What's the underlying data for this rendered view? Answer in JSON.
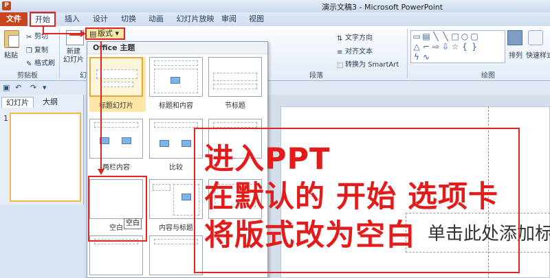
{
  "window": {
    "title": "演示文稿3 - Microsoft PowerPoint",
    "app_icon_label": "P"
  },
  "ribbon_tabs": [
    "文件",
    "开始",
    "插入",
    "设计",
    "切换",
    "动画",
    "幻灯片放映",
    "审阅",
    "视图"
  ],
  "clipboard": {
    "paste": "粘贴",
    "cut": "剪切",
    "copy": "复制",
    "format_painter": "格式刷",
    "group_label": "剪贴板"
  },
  "slides": {
    "new_slide": "新建\n幻灯片",
    "layout": "版式",
    "group_label": "幻"
  },
  "paragraph": {
    "text_direction": "文字方向",
    "align_text": "对齐文本",
    "convert_smartart": "转换为 SmartArt",
    "group_label": "段落"
  },
  "drawing": {
    "arrange": "排列",
    "quick_styles": "快速样式",
    "group_label": "绘图"
  },
  "panel": {
    "tab_slides": "幻灯片",
    "tab_outline": "大纲",
    "slide_number": "1"
  },
  "layout_dropdown": {
    "header": "Office 主题",
    "items": [
      "标题幻灯片",
      "标题和内容",
      "节标题",
      "两栏内容",
      "比较",
      "",
      "空白",
      "内容与标题",
      ""
    ],
    "tooltip": "空白"
  },
  "editor": {
    "placeholder_text": "单击此处添加标"
  },
  "annotation": {
    "lines": [
      "进入PPT",
      "在默认的 开始 选项卡",
      "将版式改为空白"
    ]
  },
  "colors": {
    "annotation_red": "#e31b1b",
    "file_tab": "#c9451c"
  }
}
